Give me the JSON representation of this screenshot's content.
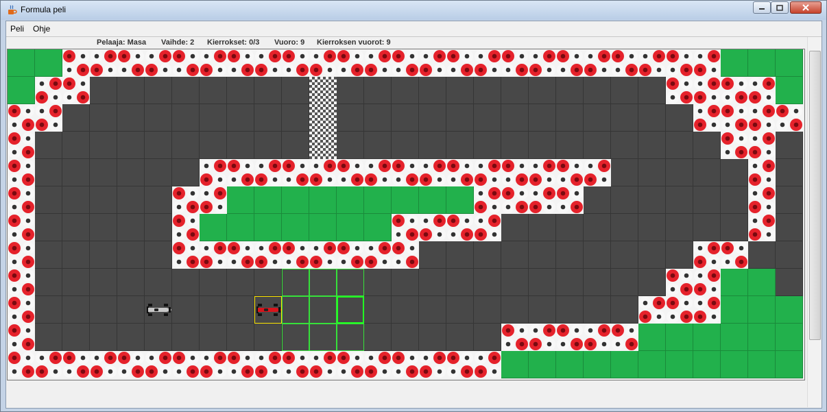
{
  "window": {
    "title": "Formula peli",
    "icon": "java-cup-icon"
  },
  "menu": [
    "Peli",
    "Ohje"
  ],
  "status": {
    "player_label": "Pelaaja: Masa",
    "gear_label": "Vaihde: 2",
    "laps_label": "Kierrokset: 0/3",
    "turn_label": "Vuoro: 9",
    "lap_turns_label": "Kierroksen vuorot: 9"
  },
  "colors": {
    "road": "#484848",
    "grass": "#22b14c",
    "tyre_red": "#e5222b",
    "tyre_white": "#f8f8f8",
    "move_highlight": "#36e23a",
    "selected_highlight": "#ffe600"
  },
  "track": {
    "cols": 29,
    "rows": 12,
    "legend": {
      "G": "grass",
      "T": "tyre wall",
      ".": "road",
      "F": "finish line"
    },
    "grid": [
      "GGTTTTTTTTTTTTTTTTTTTTTTTTGGG",
      "GTT........F............TTTTG",
      "TT.........F.............TTTT",
      "T..........F..............TT",
      "T......TTTTTTTTTTTTTTT.....T",
      "T.....TTGGGGGGGGGTTTT......T",
      "T.....TGGGGGGGTTTT.........T",
      "T.....TTTTTTTTT..........TT",
      "T.......................TTGG",
      "T......................TTTGGG",
      "T.................TTTTTGGGGGG",
      "TTTTTTTTTTTTTTTTTTGGGGGGGGGGG"
    ]
  },
  "cars": [
    {
      "name": "player-car",
      "color": "red",
      "col": 9,
      "row": 9,
      "selected": true
    },
    {
      "name": "opponent-car",
      "color": "grey",
      "col": 5,
      "row": 9,
      "selected": false
    }
  ],
  "moves": {
    "origin_col": 10,
    "origin_row": 8,
    "cols": 3,
    "rows": 3,
    "best_col": 12,
    "best_row": 9
  }
}
